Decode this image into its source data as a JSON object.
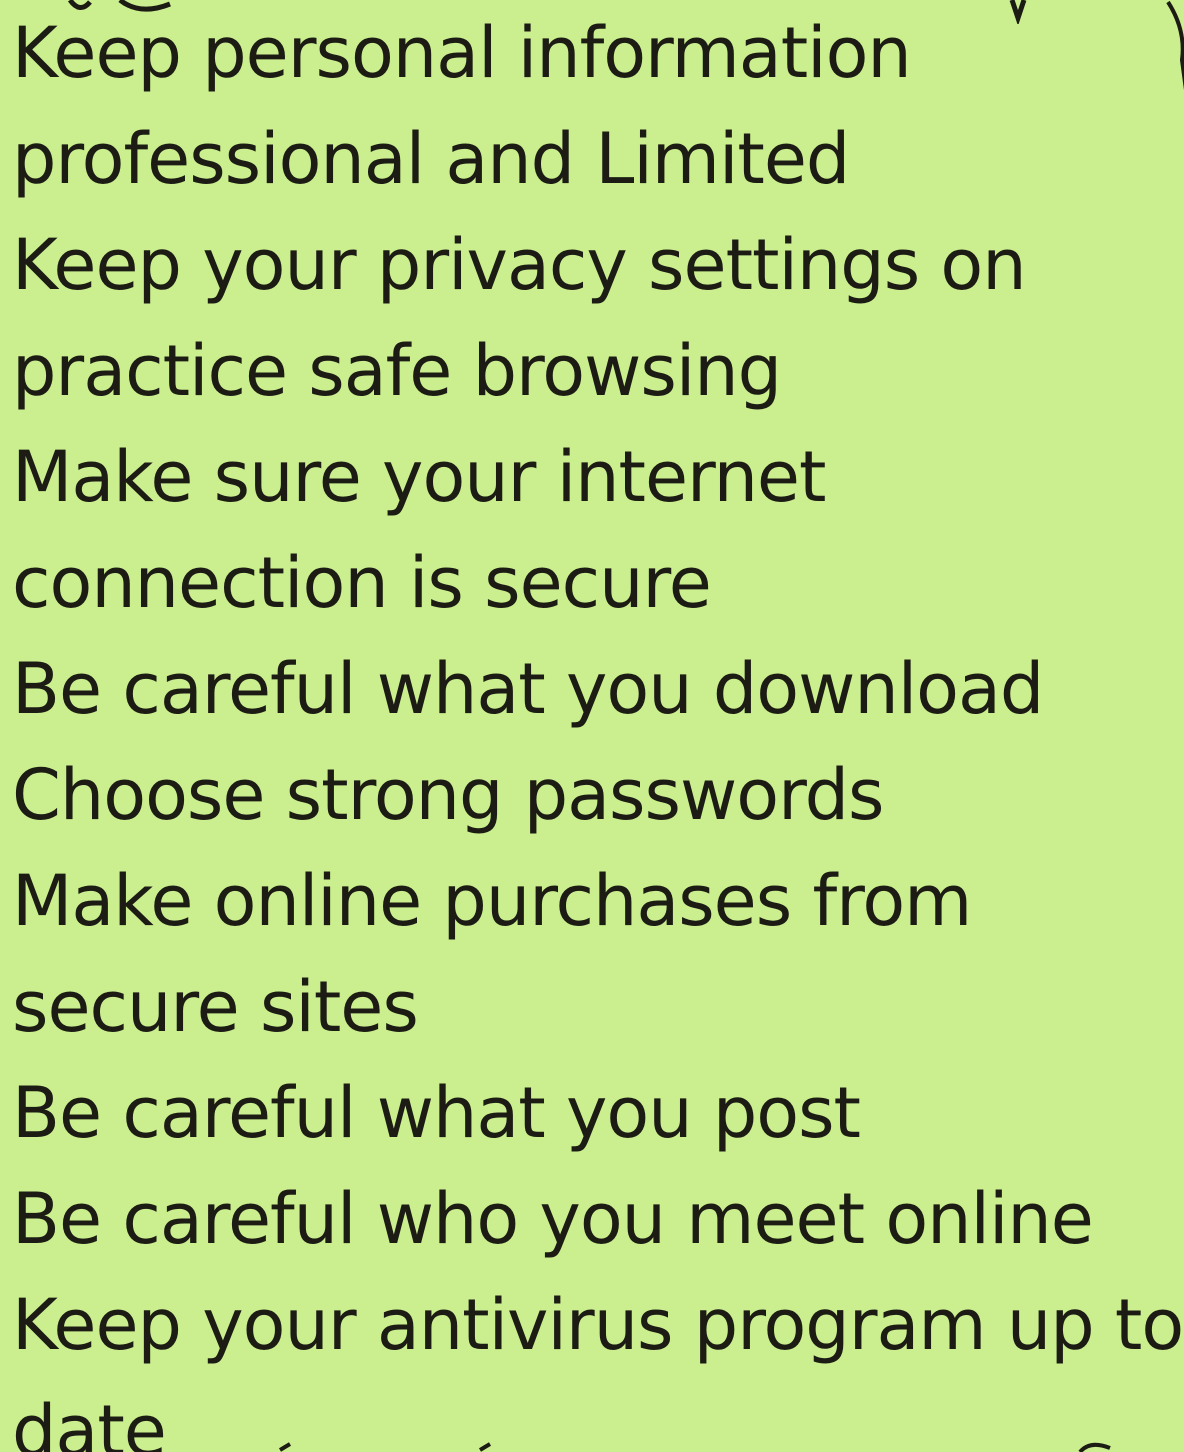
{
  "colors": {
    "background": "#cbef8f",
    "text": "#1c1c14"
  },
  "lines": [
    "Keep personal information",
    "professional and Limited",
    "Keep your privacy settings on",
    "practice safe browsing",
    "Make sure your internet",
    "connection is secure",
    "Be careful what you download",
    "Choose strong passwords",
    "Make online purchases from",
    "secure sites",
    "Be careful what you post",
    "Be careful who you meet online",
    "Keep your antivirus program up to",
    "date"
  ]
}
